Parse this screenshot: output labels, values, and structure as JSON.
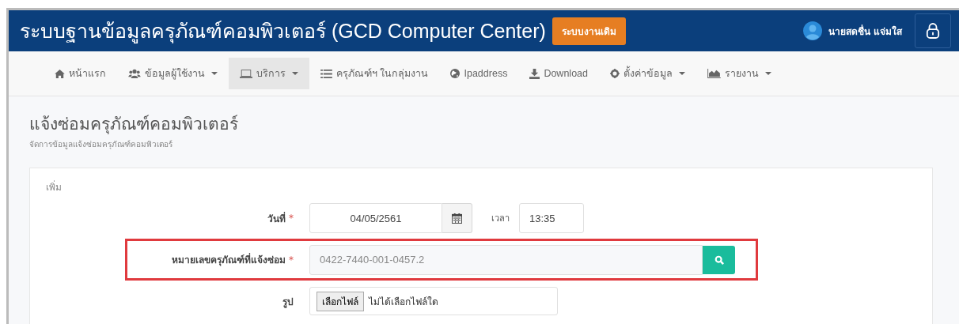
{
  "header": {
    "title": "ระบบฐานข้อมูลครุภัณฑ์คอมพิวเตอร์ (GCD Computer Center)",
    "legacy_button": "ระบบงานเดิม",
    "user_name": "นายสดชื่น แจ่มใส"
  },
  "nav": [
    {
      "label": "หน้าแรก",
      "kind": "home",
      "has_menu": false,
      "selected": false
    },
    {
      "label": "ข้อมูลผู้ใช้งาน",
      "kind": "users",
      "has_menu": true,
      "selected": false
    },
    {
      "label": "บริการ",
      "kind": "laptop",
      "has_menu": true,
      "selected": true
    },
    {
      "label": "ครุภัณฑ์ฯ ในกลุ่มงาน",
      "kind": "list",
      "has_menu": false,
      "selected": false
    },
    {
      "label": "Ipaddress",
      "kind": "globe",
      "has_menu": false,
      "selected": false
    },
    {
      "label": "Download",
      "kind": "download",
      "has_menu": false,
      "selected": false
    },
    {
      "label": "ตั้งค่าข้อมูล",
      "kind": "gear",
      "has_menu": true,
      "selected": false
    },
    {
      "label": "รายงาน",
      "kind": "chart",
      "has_menu": true,
      "selected": false
    }
  ],
  "page": {
    "title": "แจ้งซ่อมครุภัณฑ์คอมพิวเตอร์",
    "subtitle": "จัดการข้อมูลแจ้งซ่อมครุภัณฑ์คอมพิวเตอร์"
  },
  "panel": {
    "heading": "เพิ่ม",
    "fields": [
      {
        "kind": "datetime",
        "label": "วันที่",
        "required_mark": "*",
        "value": "04/05/2561",
        "time_label": "เวลา",
        "time_value": "13:35"
      },
      {
        "kind": "lookup",
        "label": "หมายเลขครุภัณฑ์ที่แจ้งซ่อม",
        "required_mark": "*",
        "value": "0422-7440-001-0457.2",
        "highlighted": true
      },
      {
        "kind": "file",
        "label": "รูป",
        "button": "เลือกไฟล์",
        "status": "ไม่ได้เลือกไฟล์ใด"
      }
    ]
  }
}
